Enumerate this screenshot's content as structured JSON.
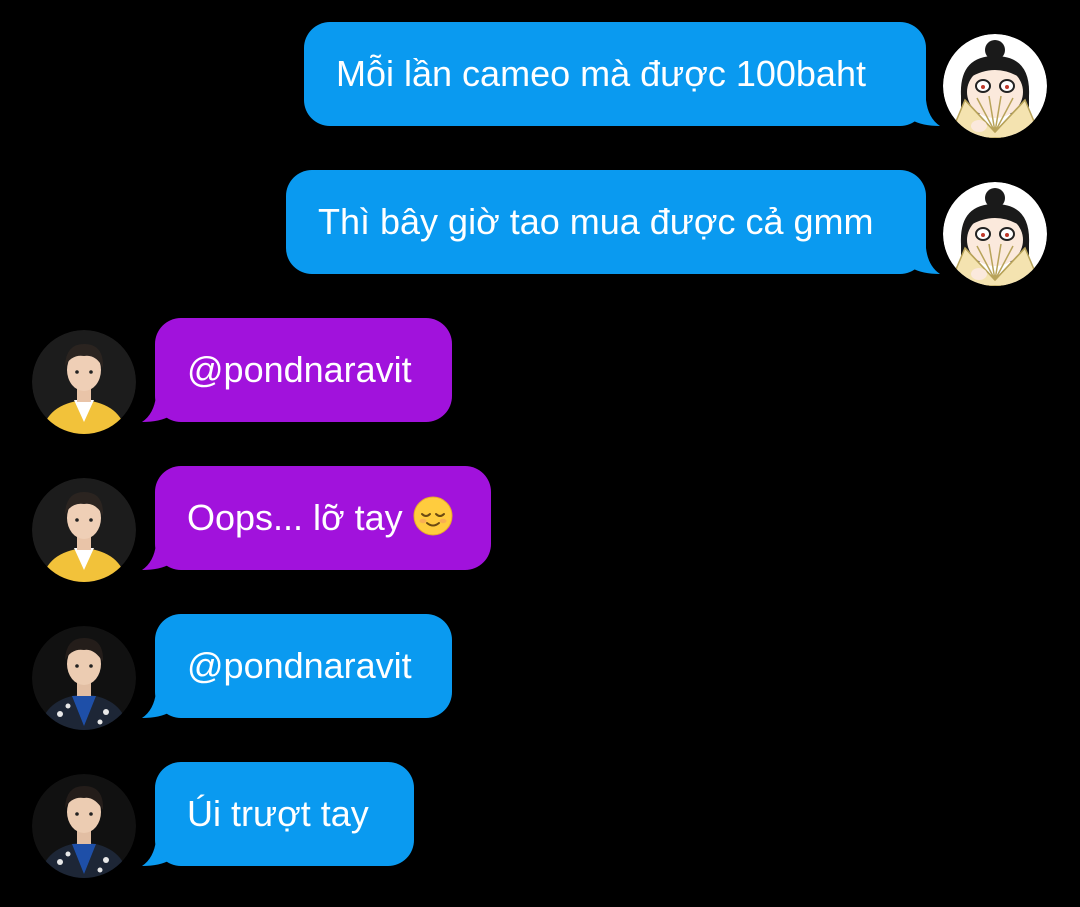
{
  "conversation": {
    "messages": [
      {
        "sender": "me",
        "text": "Mỗi lần cameo mà được 100baht",
        "bubble_color": "#0a9af0",
        "avatar": "fan-girl-avatar"
      },
      {
        "sender": "me",
        "text": "Thì bây giờ tao mua được cả gmm",
        "bubble_color": "#0a9af0",
        "avatar": "fan-girl-avatar"
      },
      {
        "sender": "other",
        "text": "@pondnaravit",
        "bubble_color": "#a112dc",
        "avatar": "yellow-jacket-person-avatar"
      },
      {
        "sender": "other",
        "text": "Oops... lỡ tay",
        "emoji": "relieved-face-icon",
        "bubble_color": "#a112dc",
        "avatar": "yellow-jacket-person-avatar"
      },
      {
        "sender": "other",
        "text": "@pondnaravit",
        "bubble_color": "#0a9af0",
        "avatar": "dark-jacket-person-avatar"
      },
      {
        "sender": "other",
        "text": "Úi trượt tay",
        "bubble_color": "#0a9af0",
        "avatar": "dark-jacket-person-avatar"
      }
    ]
  }
}
